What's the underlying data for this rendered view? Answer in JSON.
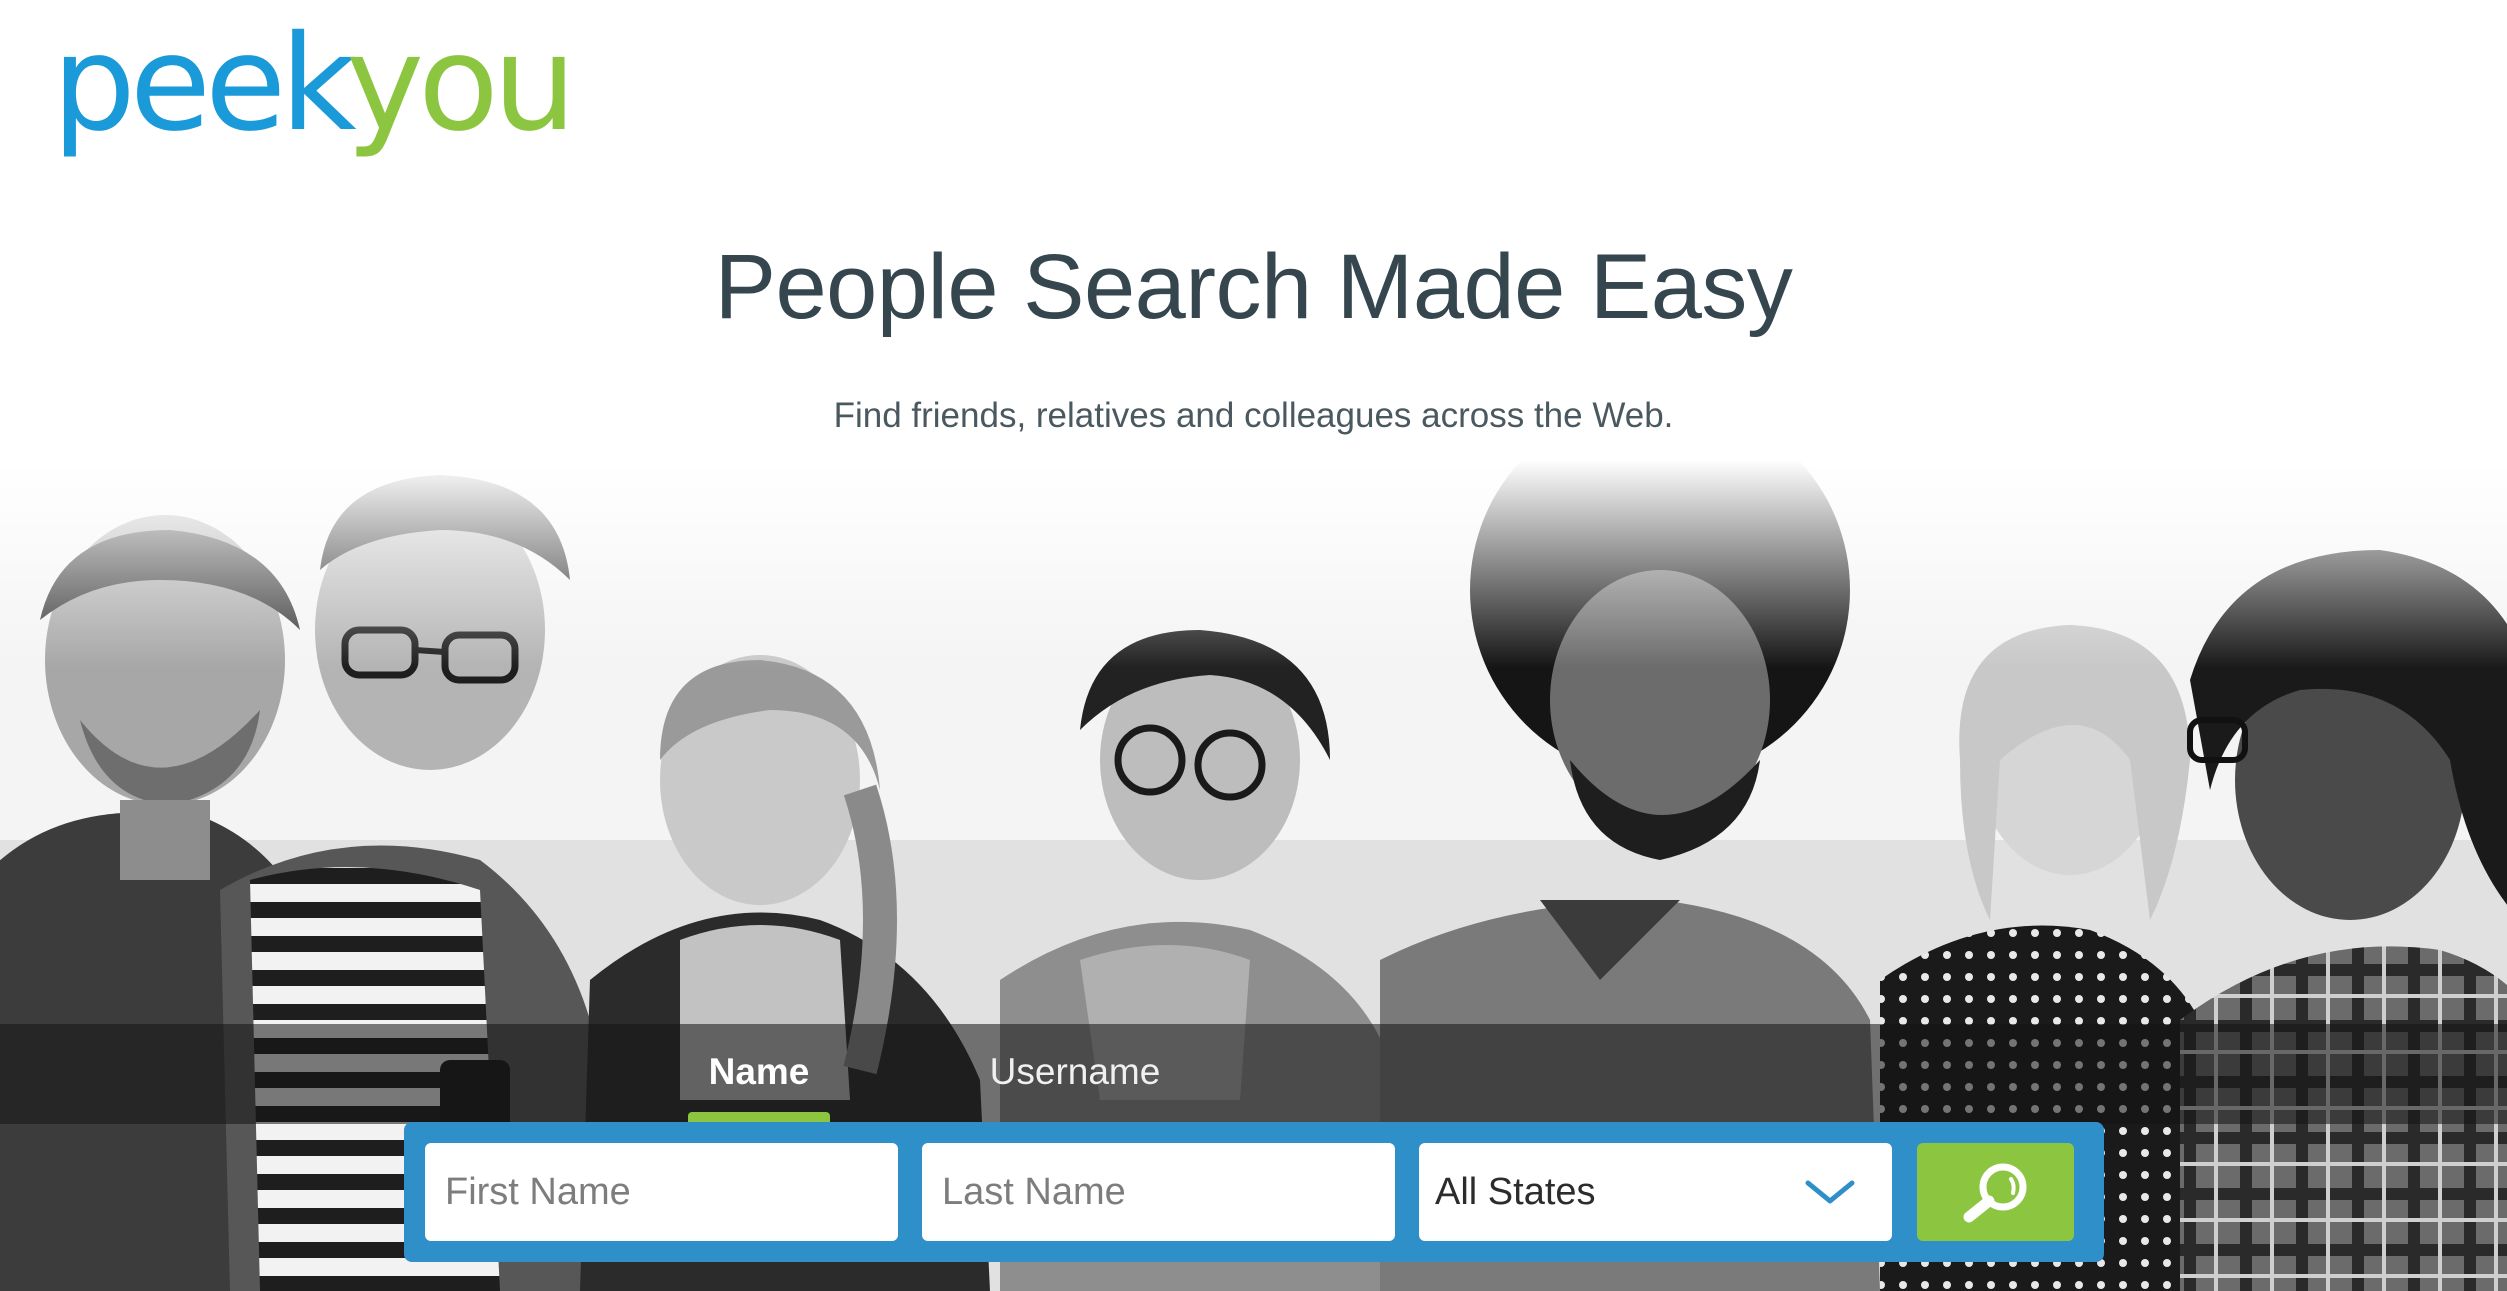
{
  "brand": {
    "logo_part1": "peek",
    "logo_part2": "you",
    "color_blue": "#1a9ad9",
    "color_green": "#8cc540"
  },
  "hero": {
    "headline": "People Search Made Easy",
    "subheadline": "Find friends, relatives and colleagues across the Web."
  },
  "search": {
    "tabs": [
      {
        "label": "Name",
        "active": true
      },
      {
        "label": "Username",
        "active": false
      }
    ],
    "first_name_placeholder": "First Name",
    "last_name_placeholder": "Last Name",
    "state_selected": "All States",
    "search_icon": "search-icon",
    "bar_color": "#2f8fc8"
  }
}
